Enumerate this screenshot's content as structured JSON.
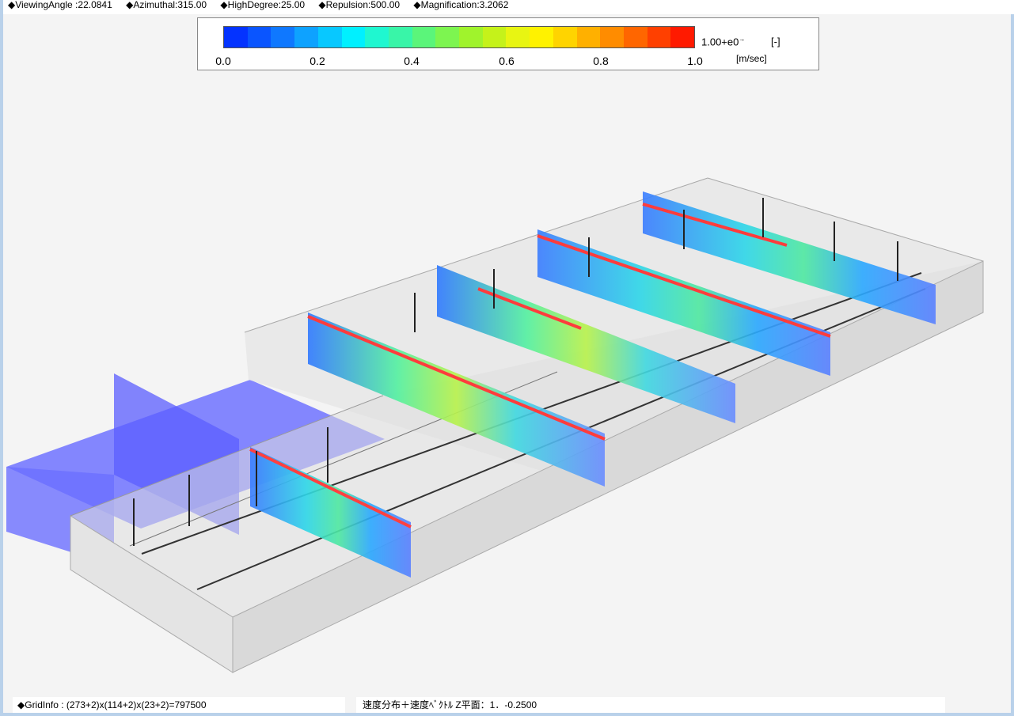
{
  "header": {
    "viewing_angle": "◆ViewingAngle :22.0841",
    "azimuthal": "◆Azimuthal:315.00",
    "high_degree": "◆HighDegree:25.00",
    "repulsion": "◆Repulsion:500.00",
    "magnification": "◆Magnification:3.2062"
  },
  "legend": {
    "colors": [
      "#0433ff",
      "#0a55ff",
      "#0f78ff",
      "#0ea2ff",
      "#08c8ff",
      "#00f0ff",
      "#1ff7d0",
      "#39f5a8",
      "#5bf57a",
      "#7df550",
      "#a0f32c",
      "#c5f21a",
      "#e8f512",
      "#fff200",
      "#ffd400",
      "#ffb000",
      "#ff8c00",
      "#ff6600",
      "#ff4000",
      "#ff1a00"
    ],
    "ticks": [
      "0.0",
      "0.2",
      "0.4",
      "0.6",
      "0.8",
      "1.0"
    ],
    "scale": "1.00+e0",
    "scale_mark": "→",
    "unit_dimless": "[-]",
    "unit_velocity": "[m/sec]"
  },
  "status": {
    "grid_info": "◆GridInfo : (273+2)x(114+2)x(23+2)=797500",
    "plane_info": "速度分布＋速度ﾍﾞｸﾄﾙ Z平面：1．-0.2500"
  }
}
